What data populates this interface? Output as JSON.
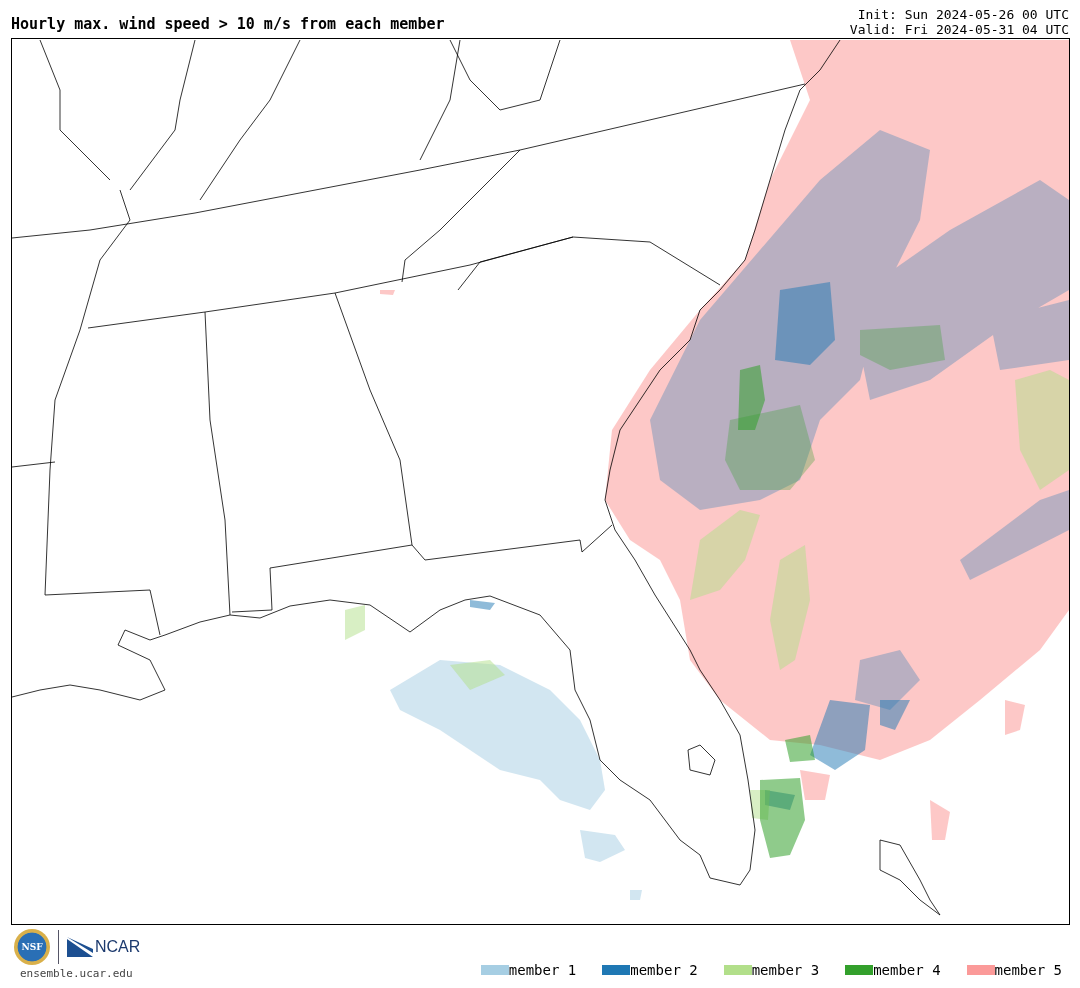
{
  "plot": {
    "title": "Hourly max. wind speed > 10 m/s from each member",
    "init": "Init: Sun 2024-05-26 00 UTC",
    "valid": "Valid: Fri 2024-05-31 04 UTC"
  },
  "logos": {
    "nsf": "NSF",
    "ncar": "NCAR"
  },
  "site": "ensemble.ucar.edu",
  "legend": [
    {
      "label": "member 1",
      "color": "#a6cee3"
    },
    {
      "label": "member 2",
      "color": "#1f78b4"
    },
    {
      "label": "member 3",
      "color": "#b2df8a"
    },
    {
      "label": "member 4",
      "color": "#33a02c"
    },
    {
      "label": "member 5",
      "color": "#fb9a99"
    }
  ]
}
